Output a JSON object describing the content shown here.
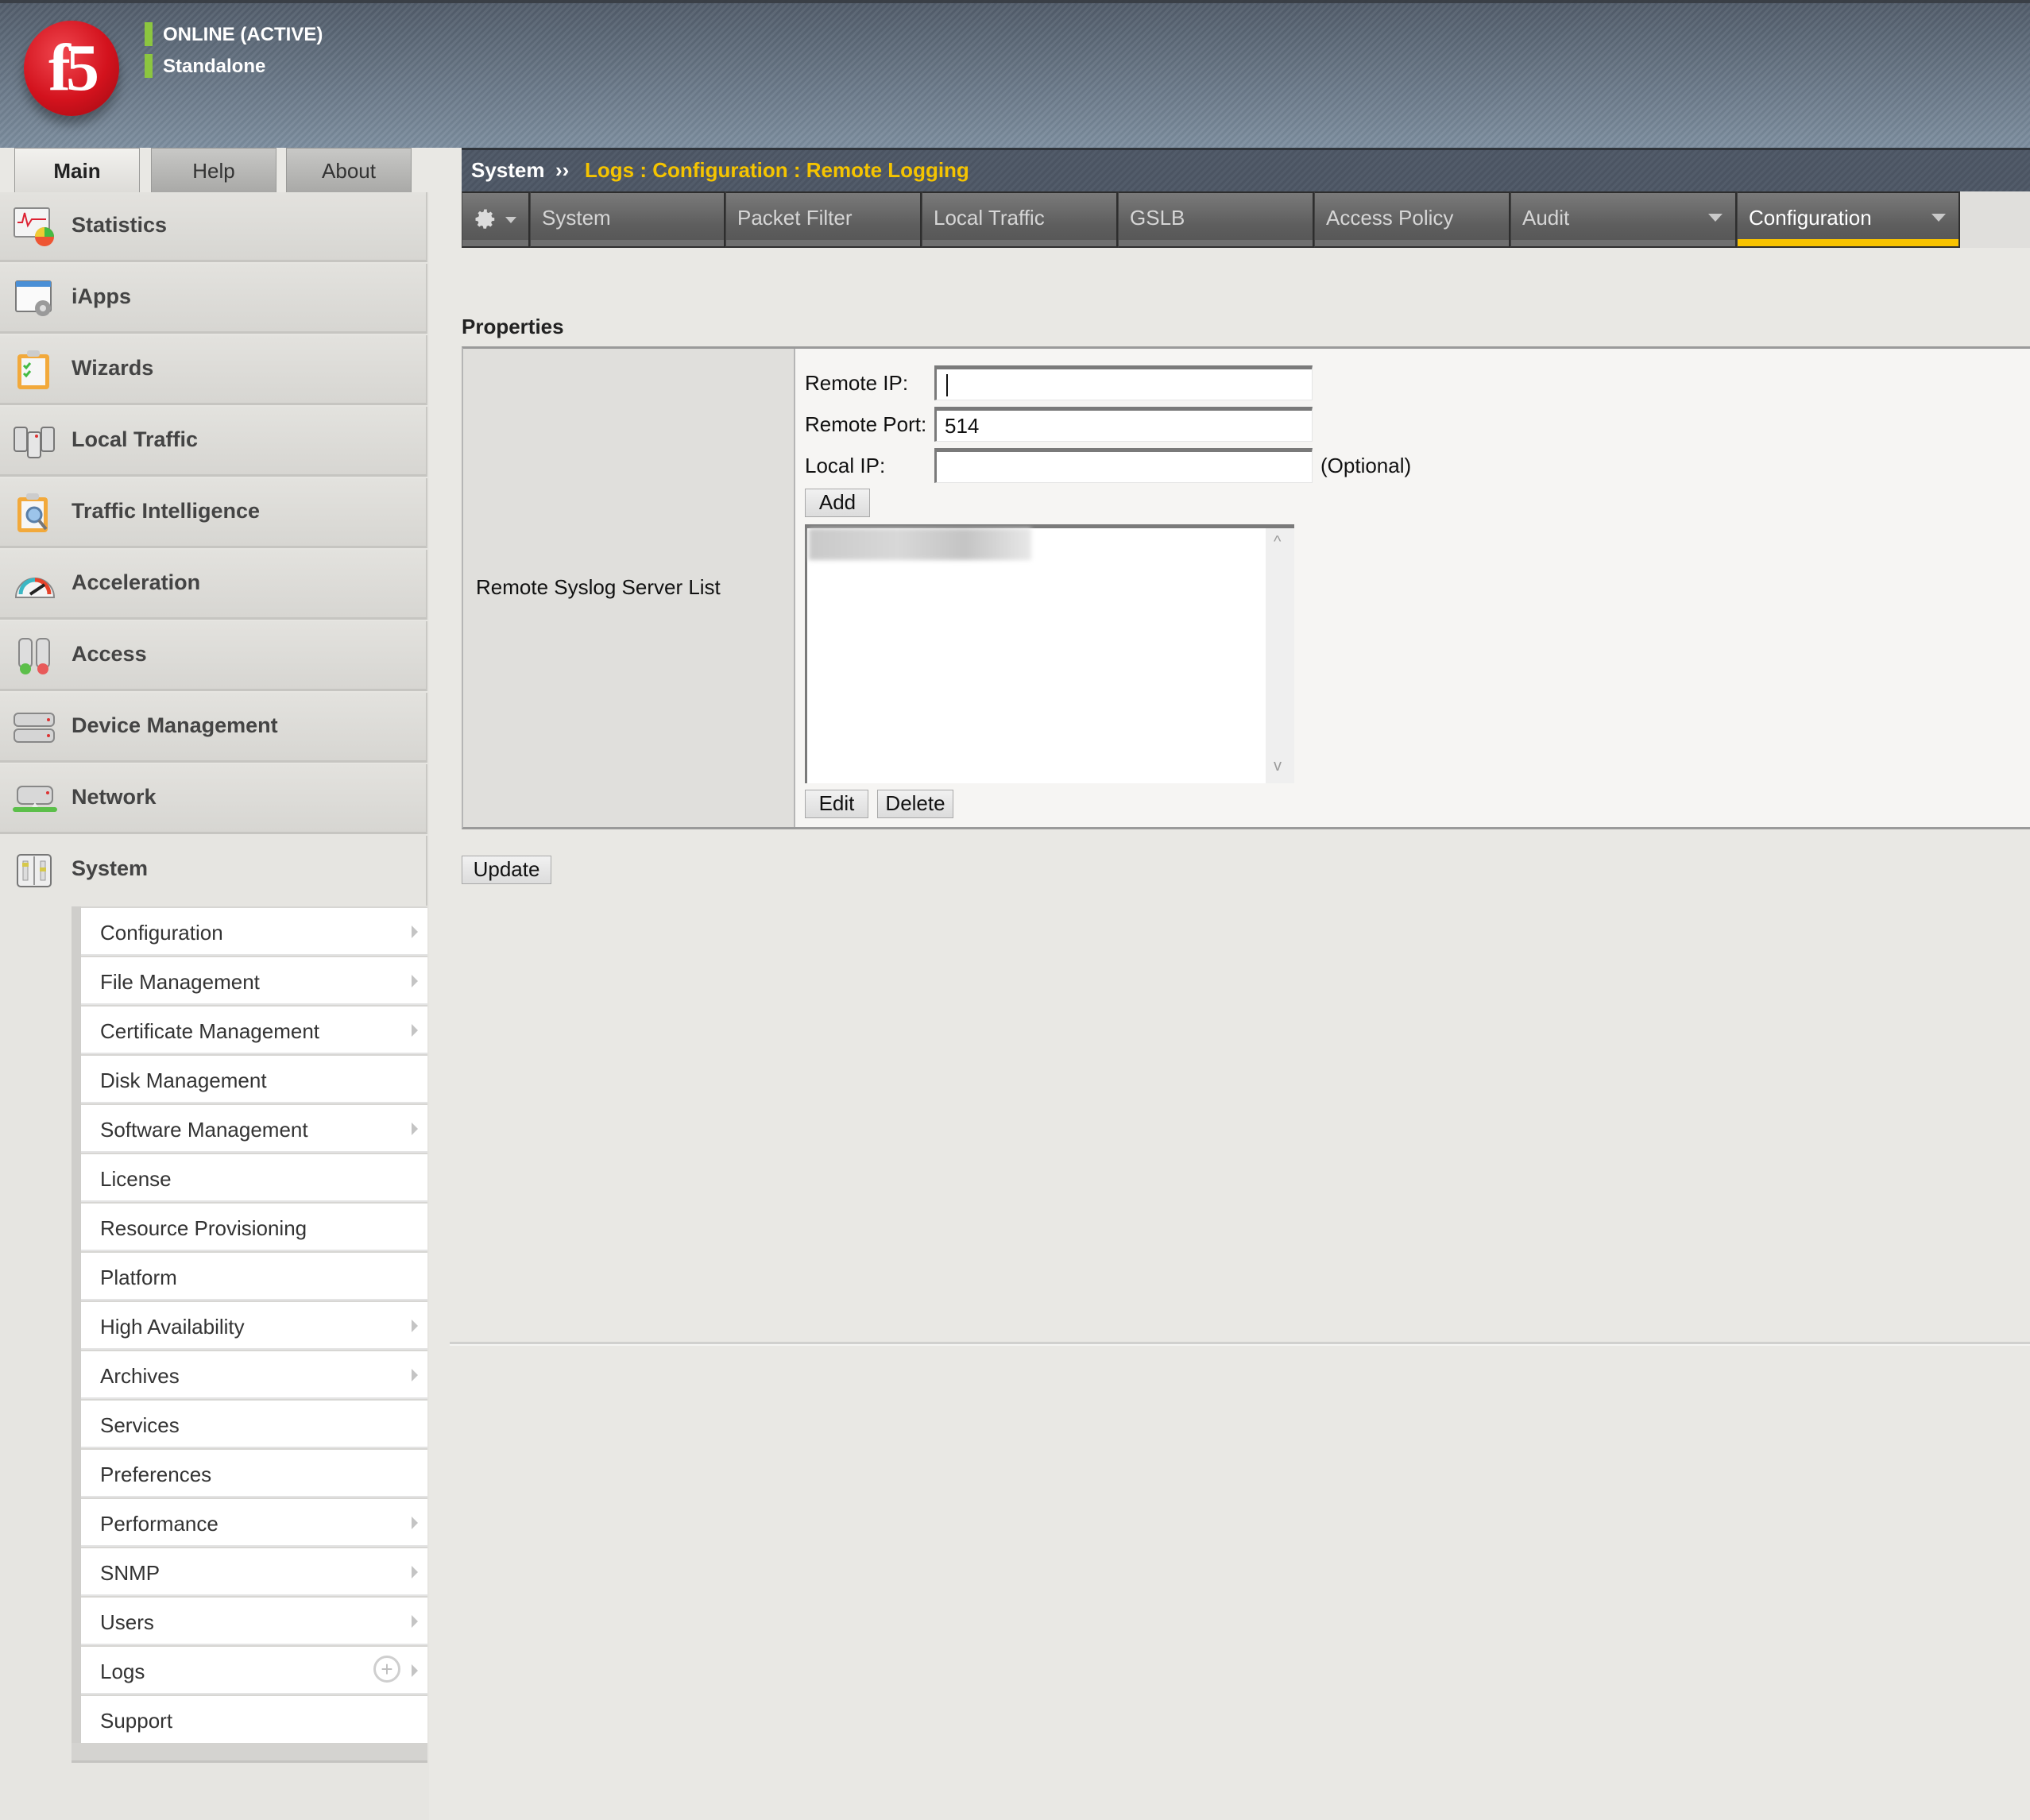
{
  "header": {
    "logo_text": "f5",
    "status_primary": "ONLINE (ACTIVE)",
    "status_secondary": "Standalone",
    "status_color": "#8cc63f"
  },
  "main_tabs": [
    {
      "label": "Main",
      "active": true
    },
    {
      "label": "Help",
      "active": false
    },
    {
      "label": "About",
      "active": false
    }
  ],
  "breadcrumb": {
    "root": "System",
    "separator": "››",
    "path": "Logs : Configuration : Remote Logging",
    "accent_color": "#f5c400"
  },
  "nav_tabs": {
    "gear_icon": "gear-icon",
    "items": [
      {
        "label": "System",
        "dropdown": false,
        "active": false
      },
      {
        "label": "Packet Filter",
        "dropdown": false,
        "active": false
      },
      {
        "label": "Local Traffic",
        "dropdown": false,
        "active": false
      },
      {
        "label": "GSLB",
        "dropdown": false,
        "active": false
      },
      {
        "label": "Access Policy",
        "dropdown": false,
        "active": false
      },
      {
        "label": "Audit",
        "dropdown": true,
        "active": false
      },
      {
        "label": "Configuration",
        "dropdown": true,
        "active": true
      }
    ],
    "active_color": "#f8c300"
  },
  "sidebar": {
    "items": [
      {
        "label": "Statistics",
        "icon": "statistics-icon"
      },
      {
        "label": "iApps",
        "icon": "iapps-icon"
      },
      {
        "label": "Wizards",
        "icon": "wizards-icon"
      },
      {
        "label": "Local Traffic",
        "icon": "local-traffic-icon"
      },
      {
        "label": "Traffic Intelligence",
        "icon": "traffic-intelligence-icon"
      },
      {
        "label": "Acceleration",
        "icon": "acceleration-icon"
      },
      {
        "label": "Access",
        "icon": "access-icon"
      },
      {
        "label": "Device Management",
        "icon": "device-management-icon"
      },
      {
        "label": "Network",
        "icon": "network-icon"
      },
      {
        "label": "System",
        "icon": "system-icon",
        "expanded": true
      }
    ],
    "submenu": [
      {
        "label": "Configuration",
        "has_arrow": true
      },
      {
        "label": "File Management",
        "has_arrow": true
      },
      {
        "label": "Certificate Management",
        "has_arrow": true
      },
      {
        "label": "Disk Management",
        "has_arrow": false
      },
      {
        "label": "Software Management",
        "has_arrow": true
      },
      {
        "label": "License",
        "has_arrow": false
      },
      {
        "label": "Resource Provisioning",
        "has_arrow": false
      },
      {
        "label": "Platform",
        "has_arrow": false
      },
      {
        "label": "High Availability",
        "has_arrow": true
      },
      {
        "label": "Archives",
        "has_arrow": true
      },
      {
        "label": "Services",
        "has_arrow": false
      },
      {
        "label": "Preferences",
        "has_arrow": false
      },
      {
        "label": "Performance",
        "has_arrow": true
      },
      {
        "label": "SNMP",
        "has_arrow": true
      },
      {
        "label": "Users",
        "has_arrow": true
      },
      {
        "label": "Logs",
        "has_arrow": true,
        "has_plus": true,
        "plus_symbol": "+"
      },
      {
        "label": "Support",
        "has_arrow": false
      }
    ]
  },
  "properties": {
    "title": "Properties",
    "row_label": "Remote Syslog Server List",
    "fields": {
      "remote_ip": {
        "label": "Remote IP:",
        "value": ""
      },
      "remote_port": {
        "label": "Remote Port:",
        "value": "514"
      },
      "local_ip": {
        "label": "Local IP:",
        "value": "",
        "hint": "(Optional)"
      }
    },
    "add_label": "Add",
    "server_list": [
      "[redacted]"
    ],
    "scroll_up": "^",
    "scroll_down": "v",
    "edit_label": "Edit",
    "delete_label": "Delete"
  },
  "update_label": "Update"
}
